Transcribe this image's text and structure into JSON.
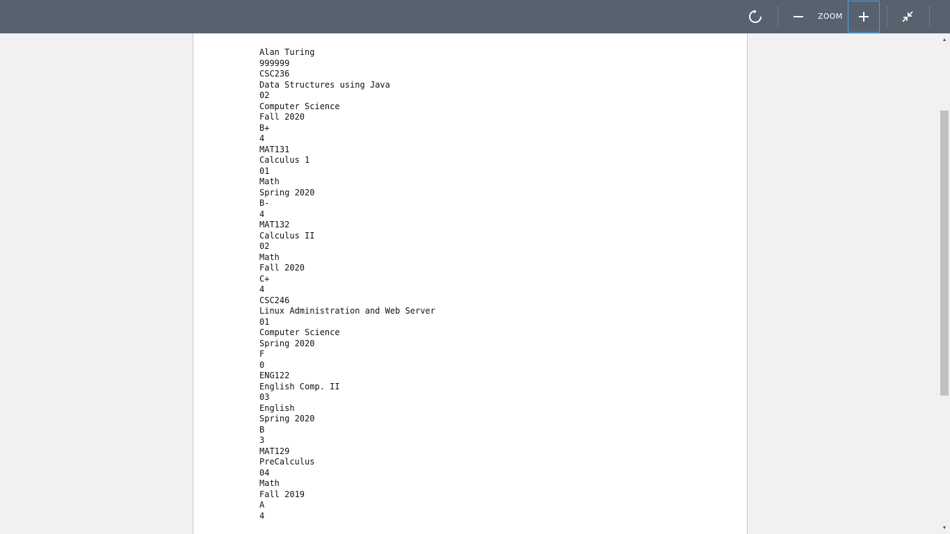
{
  "toolbar": {
    "zoom_label": "ZOOM",
    "icons": {
      "reset": "refresh-icon",
      "zoom_out": "minus-icon",
      "zoom_in": "plus-icon",
      "collapse": "collapse-icon"
    },
    "colors": {
      "background": "#56636f",
      "active_border": "#4aa3df"
    }
  },
  "document": {
    "lines": [
      "Alan Turing",
      "999999",
      "CSC236",
      "Data Structures using Java",
      "02",
      "Computer Science",
      "Fall 2020",
      "B+",
      "4",
      "MAT131",
      "Calculus 1",
      "01",
      "Math",
      "Spring 2020",
      "B-",
      "4",
      "MAT132",
      "Calculus II",
      "02",
      "Math",
      "Fall 2020",
      "C+",
      "4",
      "CSC246",
      "Linux Administration and Web Server",
      "01",
      "Computer Science",
      "Spring 2020",
      "F",
      "0",
      "ENG122",
      "English Comp. II",
      "03",
      "English",
      "Spring 2020",
      "B",
      "3",
      "MAT129",
      "PreCalculus",
      "04",
      "Math",
      "Fall 2019",
      "A",
      "4"
    ]
  }
}
